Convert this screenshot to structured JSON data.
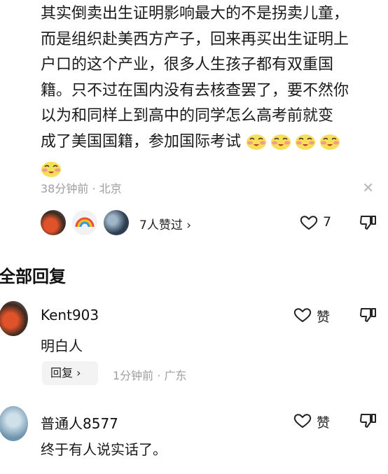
{
  "post": {
    "text_lines": [
      "其实倒卖出生证明影响最大的不是拐卖儿童，",
      "而是组织赴美西方产子，回来再买出生证明上",
      "户口的这个产业，很多人生孩子都有双重国",
      "籍。只不过在国内没有去核查罢了，要不然你",
      "以为和同样上到高中的同学怎么高考前就变",
      "成了美国国籍，参加国际考试"
    ],
    "emoji_icon": "blushing-smile-emoji",
    "time": "38分钟前",
    "location": "北京",
    "likers_label": "7人赞过",
    "like_count": "7"
  },
  "replies_header": "全部回复",
  "replies": [
    {
      "name": "Kent903",
      "text": "明白人",
      "reply_label": "回复",
      "time": "1分钟前",
      "location": "广东",
      "like_label": "赞"
    },
    {
      "name": "普通人8577",
      "text": "终于有人说实话了。",
      "like_label": "赞"
    }
  ],
  "colors": {
    "meta_gray": "#9e9e9e",
    "text": "#1a1a1a",
    "reply_button_bg": "#f3f3f3"
  }
}
